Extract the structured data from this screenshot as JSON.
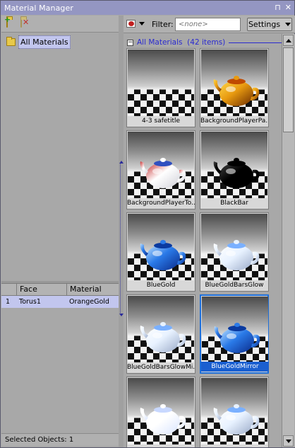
{
  "window": {
    "title": "Material Manager",
    "pin_glyph": "⊓",
    "close_glyph": "✕"
  },
  "tree": {
    "root_label": "All Materials"
  },
  "objects_table": {
    "columns": [
      "",
      "Face",
      "Material"
    ],
    "rows": [
      {
        "index": "1",
        "face": "Torus1",
        "material": "OrangeGold"
      }
    ]
  },
  "status": {
    "selected_objects": "Selected Objects: 1"
  },
  "filter": {
    "label": "Filter:",
    "placeholder": "<none>"
  },
  "settings_label": "Settings",
  "group": {
    "name": "All Materials",
    "count": "(42 items)",
    "toggle": "−"
  },
  "materials": [
    {
      "name": "4-3 safetitle",
      "pot": "none",
      "selected": false
    },
    {
      "name": "BackgroundPlayerPa...",
      "pot": "orangegold",
      "selected": false
    },
    {
      "name": "BackgroundPlayerTo...",
      "pot": "stripes",
      "selected": false
    },
    {
      "name": "BlackBar",
      "pot": "black",
      "selected": false
    },
    {
      "name": "BlueGold",
      "pot": "blue",
      "selected": false
    },
    {
      "name": "BlueGoldBarsGlow",
      "pot": "glow",
      "selected": false
    },
    {
      "name": "BlueGoldBarsGlowMi...",
      "pot": "glow",
      "selected": false
    },
    {
      "name": "BlueGoldMirror",
      "pot": "blue",
      "selected": true
    },
    {
      "name": "",
      "pot": "white",
      "selected": false
    },
    {
      "name": "",
      "pot": "glow",
      "selected": false
    }
  ],
  "colors": {
    "selection_accent": "#1a5fd0",
    "title_bar": "#9496c2",
    "group_header": "#2a2ad0"
  }
}
